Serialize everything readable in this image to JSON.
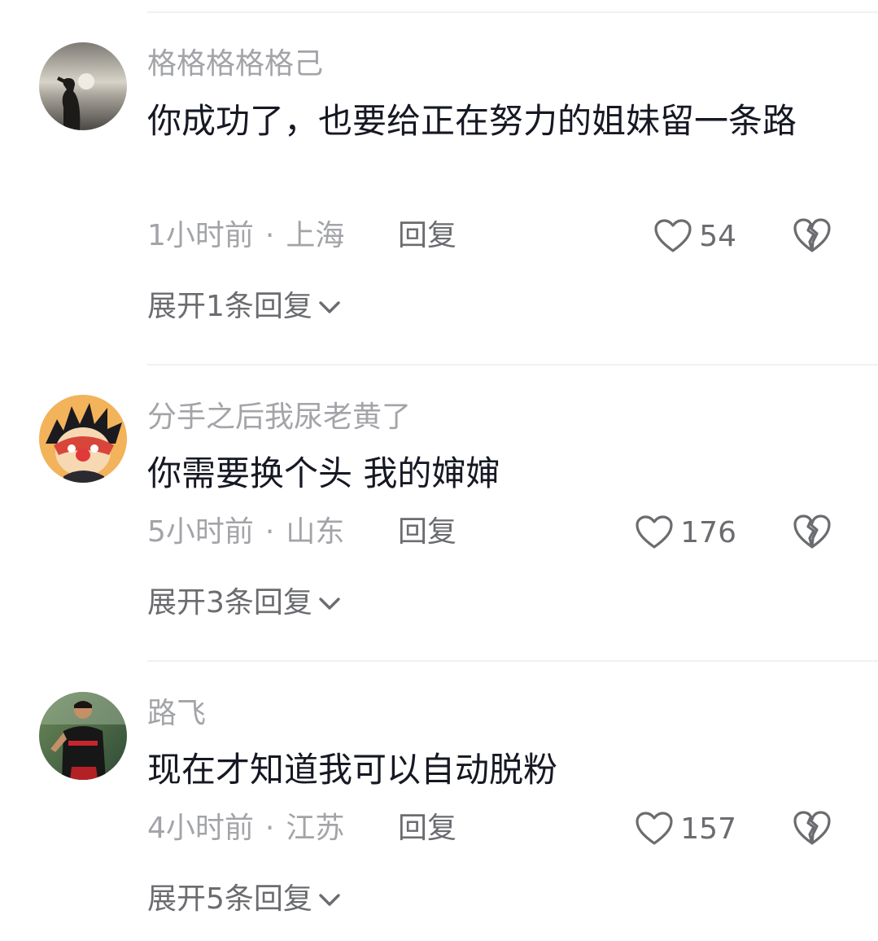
{
  "comments": [
    {
      "username": "格格格格格己",
      "text": "你成功了，也要给正在努力的姐妹留一条路",
      "time": "1小时前",
      "location": "上海",
      "reply_label": "回复",
      "likes": "54",
      "expand_label": "展开1条回复"
    },
    {
      "username": "分手之后我尿老黄了",
      "text": "你需要换个头 我的婶婶",
      "time": "5小时前",
      "location": "山东",
      "reply_label": "回复",
      "likes": "176",
      "expand_label": "展开3条回复"
    },
    {
      "username": "路飞",
      "text": "现在才知道我可以自动脱粉",
      "time": "4小时前",
      "location": "江苏",
      "reply_label": "回复",
      "likes": "157",
      "expand_label": "展开5条回复"
    }
  ],
  "separator": "·",
  "colors": {
    "username": "#a3a4a8",
    "text": "#161823",
    "secondary": "#6b6c70",
    "divider": "#f1f1f2"
  },
  "icons": [
    "heart-icon",
    "broken-heart-icon",
    "chevron-down-icon"
  ]
}
